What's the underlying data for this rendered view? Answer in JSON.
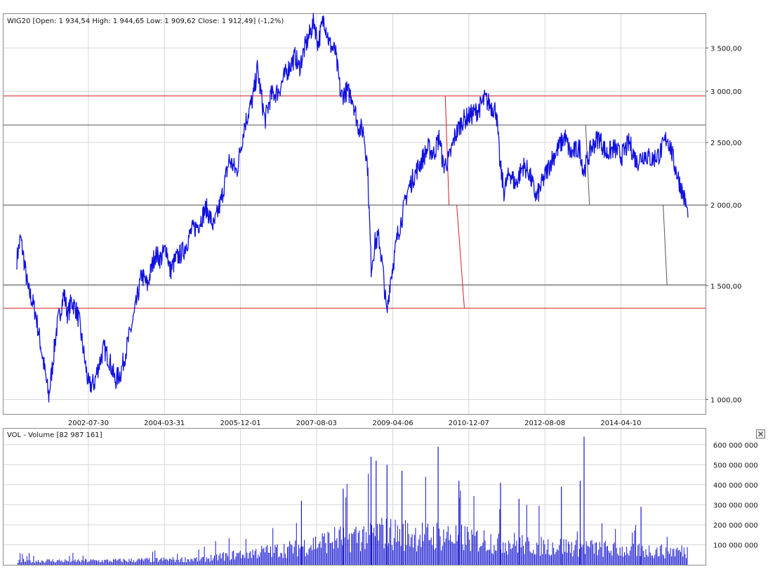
{
  "price_panel": {
    "header": "WIG20 [Open: 1 934,54  High: 1 944,65  Low: 1 909,62  Close: 1 912,49]  (-1,2%)"
  },
  "volume_panel": {
    "header": "VOL - Volume [82 987 161]"
  },
  "colors": {
    "price_line": "#1010e0",
    "volume_bar": "#1515d0",
    "red_level": "#d21e1e",
    "grey_level": "#555555",
    "grid": "#d6d6d6",
    "frame": "#8a8a8a"
  },
  "chart_data": [
    {
      "type": "line",
      "series_key": "WIG20",
      "y_scale": "log",
      "ylim": [
        950,
        3950
      ],
      "x_range": [
        "2001-01-02",
        "2015-09-30"
      ],
      "x_tick_labels": [
        {
          "date": "2002-07-30",
          "label": "2002-07-30"
        },
        {
          "date": "2004-03-31",
          "label": "2004-03-31"
        },
        {
          "date": "2005-12-01",
          "label": "2005-12-01"
        },
        {
          "date": "2007-08-03",
          "label": "2007-08-03"
        },
        {
          "date": "2009-04-06",
          "label": "2009-04-06"
        },
        {
          "date": "2010-12-07",
          "label": "2010-12-07"
        },
        {
          "date": "2012-08-08",
          "label": "2012-08-08"
        },
        {
          "date": "2014-04-10",
          "label": "2014-04-10"
        }
      ],
      "y_ticks": [
        {
          "value": 1000,
          "label": "1 000,00"
        },
        {
          "value": 1500,
          "label": "1 500,00"
        },
        {
          "value": 2000,
          "label": "2 000,00"
        },
        {
          "value": 2500,
          "label": "2 500,00"
        },
        {
          "value": 3000,
          "label": "3 000,00"
        },
        {
          "value": 3500,
          "label": "3 500,00"
        }
      ],
      "points": [
        [
          "2001-01-02",
          1650
        ],
        [
          "2001-02-01",
          1780
        ],
        [
          "2001-03-01",
          1640
        ],
        [
          "2001-04-01",
          1480
        ],
        [
          "2001-05-01",
          1430
        ],
        [
          "2001-06-01",
          1360
        ],
        [
          "2001-07-01",
          1250
        ],
        [
          "2001-08-01",
          1150
        ],
        [
          "2001-09-15",
          1010
        ],
        [
          "2001-10-15",
          1130
        ],
        [
          "2001-11-15",
          1280
        ],
        [
          "2002-01-15",
          1460
        ],
        [
          "2002-02-15",
          1350
        ],
        [
          "2002-03-15",
          1420
        ],
        [
          "2002-04-15",
          1390
        ],
        [
          "2002-05-15",
          1330
        ],
        [
          "2002-07-01",
          1150
        ],
        [
          "2002-08-01",
          1050
        ],
        [
          "2002-09-15",
          1060
        ],
        [
          "2002-10-15",
          1120
        ],
        [
          "2002-12-01",
          1200
        ],
        [
          "2003-01-15",
          1150
        ],
        [
          "2003-03-01",
          1070
        ],
        [
          "2003-04-15",
          1100
        ],
        [
          "2003-06-01",
          1200
        ],
        [
          "2003-08-01",
          1350
        ],
        [
          "2003-10-01",
          1560
        ],
        [
          "2003-11-15",
          1500
        ],
        [
          "2004-01-15",
          1680
        ],
        [
          "2004-03-01",
          1650
        ],
        [
          "2004-04-15",
          1720
        ],
        [
          "2004-05-15",
          1580
        ],
        [
          "2004-07-01",
          1650
        ],
        [
          "2004-09-01",
          1700
        ],
        [
          "2004-11-01",
          1820
        ],
        [
          "2005-01-01",
          1870
        ],
        [
          "2005-03-01",
          1980
        ],
        [
          "2005-05-01",
          1850
        ],
        [
          "2005-07-01",
          2040
        ],
        [
          "2005-09-01",
          2350
        ],
        [
          "2005-11-01",
          2250
        ],
        [
          "2006-01-01",
          2650
        ],
        [
          "2006-03-15",
          2950
        ],
        [
          "2006-04-15",
          3250
        ],
        [
          "2006-06-15",
          2700
        ],
        [
          "2006-08-01",
          2950
        ],
        [
          "2006-10-01",
          3000
        ],
        [
          "2006-12-01",
          3200
        ],
        [
          "2007-02-15",
          3400
        ],
        [
          "2007-03-15",
          3250
        ],
        [
          "2007-05-01",
          3500
        ],
        [
          "2007-06-15",
          3700
        ],
        [
          "2007-07-15",
          3850
        ],
        [
          "2007-08-15",
          3550
        ],
        [
          "2007-10-01",
          3900
        ],
        [
          "2007-11-15",
          3550
        ],
        [
          "2008-01-01",
          3450
        ],
        [
          "2008-02-15",
          2950
        ],
        [
          "2008-04-01",
          3000
        ],
        [
          "2008-05-15",
          2950
        ],
        [
          "2008-07-01",
          2650
        ],
        [
          "2008-08-15",
          2600
        ],
        [
          "2008-09-15",
          2300
        ],
        [
          "2008-10-15",
          1600
        ],
        [
          "2008-11-15",
          1750
        ],
        [
          "2008-12-15",
          1780
        ],
        [
          "2009-01-15",
          1600
        ],
        [
          "2009-02-17",
          1350
        ],
        [
          "2009-03-15",
          1520
        ],
        [
          "2009-04-15",
          1650
        ],
        [
          "2009-05-15",
          1800
        ],
        [
          "2009-06-15",
          1900
        ],
        [
          "2009-08-01",
          2100
        ],
        [
          "2009-09-15",
          2200
        ],
        [
          "2009-11-01",
          2300
        ],
        [
          "2010-01-15",
          2450
        ],
        [
          "2010-03-01",
          2400
        ],
        [
          "2010-04-15",
          2550
        ],
        [
          "2010-05-15",
          2300
        ],
        [
          "2010-07-01",
          2350
        ],
        [
          "2010-08-15",
          2550
        ],
        [
          "2010-10-15",
          2700
        ],
        [
          "2010-12-15",
          2750
        ],
        [
          "2011-02-15",
          2800
        ],
        [
          "2011-04-15",
          2920
        ],
        [
          "2011-06-01",
          2850
        ],
        [
          "2011-07-15",
          2800
        ],
        [
          "2011-08-15",
          2300
        ],
        [
          "2011-09-15",
          2100
        ],
        [
          "2011-11-01",
          2250
        ],
        [
          "2011-12-15",
          2150
        ],
        [
          "2012-02-15",
          2300
        ],
        [
          "2012-04-01",
          2250
        ],
        [
          "2012-06-01",
          2050
        ],
        [
          "2012-08-01",
          2200
        ],
        [
          "2012-10-01",
          2350
        ],
        [
          "2013-01-15",
          2550
        ],
        [
          "2013-03-01",
          2400
        ],
        [
          "2013-05-15",
          2450
        ],
        [
          "2013-06-15",
          2250
        ],
        [
          "2013-08-15",
          2450
        ],
        [
          "2013-10-15",
          2550
        ],
        [
          "2013-12-15",
          2400
        ],
        [
          "2014-02-15",
          2450
        ],
        [
          "2014-04-15",
          2380
        ],
        [
          "2014-06-15",
          2500
        ],
        [
          "2014-08-15",
          2330
        ],
        [
          "2014-10-15",
          2400
        ],
        [
          "2014-12-15",
          2350
        ],
        [
          "2015-02-15",
          2400
        ],
        [
          "2015-04-15",
          2550
        ],
        [
          "2015-05-15",
          2450
        ],
        [
          "2015-06-15",
          2300
        ],
        [
          "2015-07-15",
          2200
        ],
        [
          "2015-08-15",
          2100
        ],
        [
          "2015-09-15",
          2000
        ],
        [
          "2015-09-30",
          1912
        ]
      ],
      "horizontal_levels": [
        {
          "value": 2950,
          "color": "red"
        },
        {
          "value": 2660,
          "color": "grey"
        },
        {
          "value": 2000,
          "color": "grey"
        },
        {
          "value": 1505,
          "color": "grey"
        },
        {
          "value": 1385,
          "color": "red"
        }
      ],
      "trend_segments": [
        {
          "from": [
            "2010-06-01",
            2950
          ],
          "to": [
            "2010-07-01",
            2000
          ],
          "color": "red"
        },
        {
          "from": [
            "2010-09-01",
            2000
          ],
          "to": [
            "2010-11-01",
            1385
          ],
          "color": "red"
        },
        {
          "from": [
            "2013-07-01",
            2660
          ],
          "to": [
            "2013-08-01",
            2000
          ],
          "color": "grey"
        },
        {
          "from": [
            "2015-03-15",
            2000
          ],
          "to": [
            "2015-04-15",
            1505
          ],
          "color": "grey"
        }
      ]
    },
    {
      "type": "bar",
      "series_key": "VOL",
      "ylim": [
        0,
        680000000
      ],
      "y_ticks": [
        {
          "value": 100000000,
          "label": "100 000 000"
        },
        {
          "value": 200000000,
          "label": "200 000 000"
        },
        {
          "value": 300000000,
          "label": "300 000 000"
        },
        {
          "value": 400000000,
          "label": "400 000 000"
        },
        {
          "value": 500000000,
          "label": "500 000 000"
        },
        {
          "value": 600000000,
          "label": "600 000 000"
        }
      ],
      "volume_profile": [
        [
          "2001-01-02",
          25000000
        ],
        [
          "2003-01-01",
          25000000
        ],
        [
          "2005-01-01",
          35000000
        ],
        [
          "2006-01-01",
          70000000
        ],
        [
          "2007-01-01",
          100000000
        ],
        [
          "2008-01-01",
          160000000
        ],
        [
          "2009-01-01",
          200000000
        ],
        [
          "2009-06-01",
          190000000
        ],
        [
          "2010-06-01",
          180000000
        ],
        [
          "2011-06-01",
          150000000
        ],
        [
          "2012-06-01",
          120000000
        ],
        [
          "2013-06-01",
          110000000
        ],
        [
          "2014-06-01",
          90000000
        ],
        [
          "2015-09-30",
          85000000
        ]
      ],
      "volume_spikes": [
        [
          "2007-04-01",
          320000000
        ],
        [
          "2008-03-01",
          380000000
        ],
        [
          "2008-10-10",
          540000000
        ],
        [
          "2008-11-20",
          520000000
        ],
        [
          "2009-02-15",
          500000000
        ],
        [
          "2009-06-15",
          470000000
        ],
        [
          "2010-04-01",
          590000000
        ],
        [
          "2010-09-15",
          420000000
        ],
        [
          "2011-08-15",
          410000000
        ],
        [
          "2012-01-10",
          330000000
        ],
        [
          "2012-12-15",
          390000000
        ],
        [
          "2013-05-15",
          420000000
        ],
        [
          "2013-06-15",
          640000000
        ],
        [
          "2014-09-15",
          290000000
        ]
      ]
    }
  ]
}
